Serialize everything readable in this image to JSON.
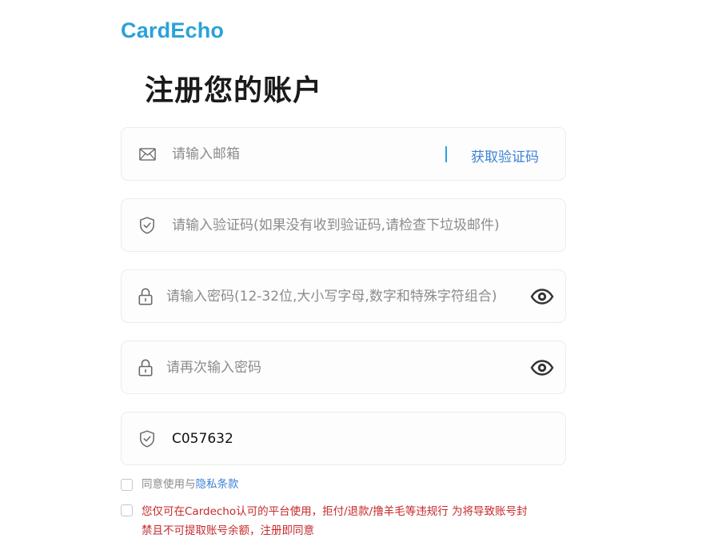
{
  "brand": {
    "name": "CardEcho",
    "color": "#2ba1d9"
  },
  "title": "注册您的账户",
  "form": {
    "email": {
      "placeholder": "请输入邮箱",
      "icon": "mail-icon",
      "send_code_label": "获取验证码"
    },
    "verify_code": {
      "placeholder": "请输入验证码(如果没有收到验证码,请检查下垃圾邮件)",
      "icon": "shield-icon"
    },
    "password": {
      "placeholder": "请输入密码(12-32位,大小写字母,数字和特殊字符组合)",
      "icon": "lock-icon",
      "toggle_icon": "eye-icon"
    },
    "confirm_password": {
      "placeholder": "请再次输入密码",
      "icon": "lock-icon",
      "toggle_icon": "eye-icon"
    },
    "invite_code": {
      "value": "C057632",
      "icon": "shield-icon"
    }
  },
  "agreements": {
    "privacy_prefix": "同意使用与",
    "privacy_link": "隐私条款",
    "warning_line1": "您仅可在Cardecho认可的平台使用，拒付/退款/撸羊毛等违规行 为将导致账号封",
    "warning_line2": "禁且不可提取账号余额，注册即同意"
  },
  "colors": {
    "accent": "#2ba1d9",
    "link": "#3d82d6",
    "warning": "#c62a2a",
    "icon": "#6a6a6a",
    "eye": "#333333"
  }
}
